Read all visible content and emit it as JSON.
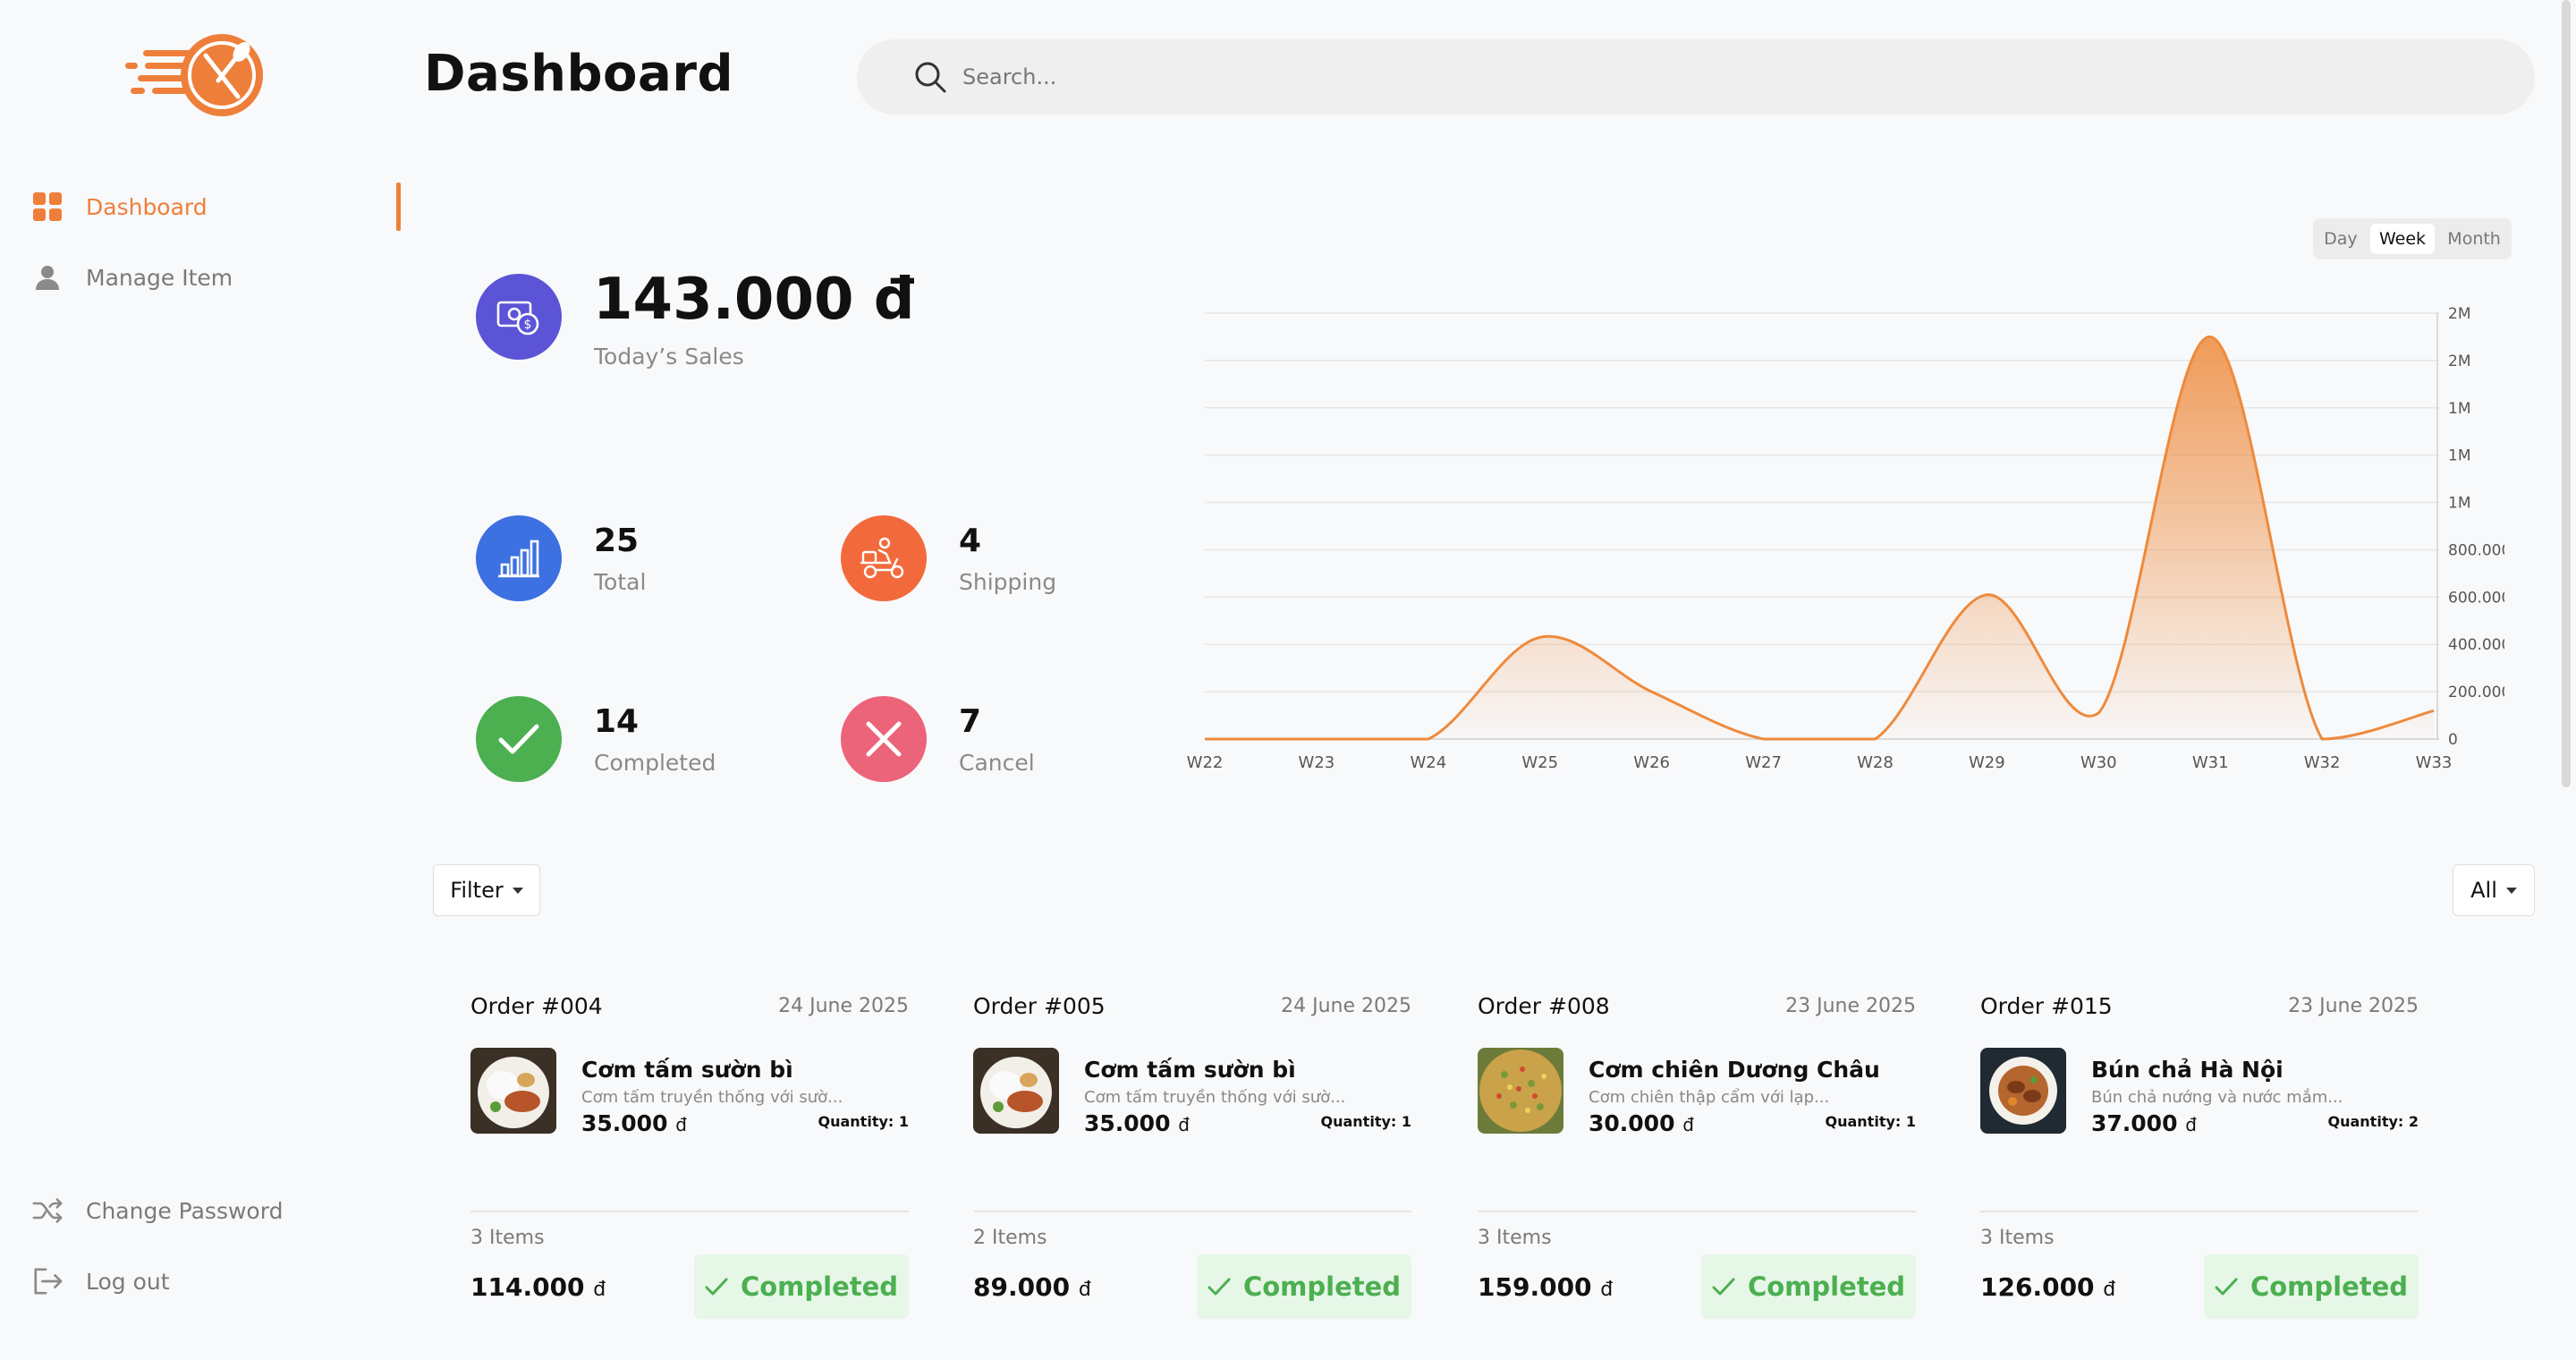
{
  "header": {
    "title": "Dashboard",
    "search_placeholder": "Search..."
  },
  "sidebar": {
    "items": [
      {
        "label": "Dashboard",
        "icon": "grid-icon",
        "active": true
      },
      {
        "label": "Manage Item",
        "icon": "user-icon",
        "active": false
      }
    ],
    "bottom": [
      {
        "label": "Change Password",
        "icon": "shuffle-icon"
      },
      {
        "label": "Log out",
        "icon": "logout-icon"
      }
    ]
  },
  "stats": {
    "sales": {
      "value": "143.000 đ",
      "label": "Today’s Sales"
    },
    "total": {
      "value": "25",
      "label": "Total"
    },
    "shipping": {
      "value": "4",
      "label": "Shipping"
    },
    "completed": {
      "value": "14",
      "label": "Completed"
    },
    "cancel": {
      "value": "7",
      "label": "Cancel"
    }
  },
  "colors": {
    "accent": "#ee7f3a",
    "sales": "#5b54d6",
    "total": "#3d70e0",
    "shipping": "#f26a3c",
    "completed": "#4caf50",
    "cancel": "#ec6479"
  },
  "chart_controls": {
    "options": [
      "Day",
      "Week",
      "Month"
    ],
    "selected": "Week"
  },
  "chart_data": {
    "type": "area",
    "x": [
      "W22",
      "W23",
      "W24",
      "W25",
      "W26",
      "W27",
      "W28",
      "W29",
      "W30",
      "W31",
      "W32",
      "W33"
    ],
    "values": [
      0,
      0,
      0,
      430000,
      200000,
      0,
      0,
      610000,
      110000,
      1700000,
      0,
      120000
    ],
    "y_ticks": [
      "0",
      "200.000",
      "400.000",
      "600.000",
      "800.000",
      "1M",
      "1M",
      "1M",
      "2M",
      "2M"
    ],
    "ylim": [
      0,
      1800000
    ],
    "y_axis_side": "right",
    "grid": true,
    "color": "#ee8a3c"
  },
  "filter": {
    "label": "Filter",
    "all_label": "All"
  },
  "orders": [
    {
      "id": "Order #004",
      "date": "24 June 2025",
      "item_name": "Cơm tấm sườn bì",
      "item_desc": "Cơm tấm truyền thống với sườ...",
      "price": "35.000",
      "currency": "đ",
      "qty_label": "Quantity: 1",
      "items_count": "3 Items",
      "total": "114.000",
      "status": "Completed"
    },
    {
      "id": "Order #005",
      "date": "24 June 2025",
      "item_name": "Cơm tấm sườn bì",
      "item_desc": "Cơm tấm truyền thống với sườ...",
      "price": "35.000",
      "currency": "đ",
      "qty_label": "Quantity: 1",
      "items_count": "2 Items",
      "total": "89.000",
      "status": "Completed"
    },
    {
      "id": "Order #008",
      "date": "23 June 2025",
      "item_name": "Cơm chiên Dương Châu",
      "item_desc": "Cơm chiên thập cẩm với lạp...",
      "price": "30.000",
      "currency": "đ",
      "qty_label": "Quantity: 1",
      "items_count": "3 Items",
      "total": "159.000",
      "status": "Completed"
    },
    {
      "id": "Order #015",
      "date": "23 June 2025",
      "item_name": "Bún chả Hà Nội",
      "item_desc": "Bún chả nướng và nước mắm...",
      "price": "37.000",
      "currency": "đ",
      "qty_label": "Quantity: 2",
      "items_count": "3 Items",
      "total": "126.000",
      "status": "Completed"
    }
  ]
}
